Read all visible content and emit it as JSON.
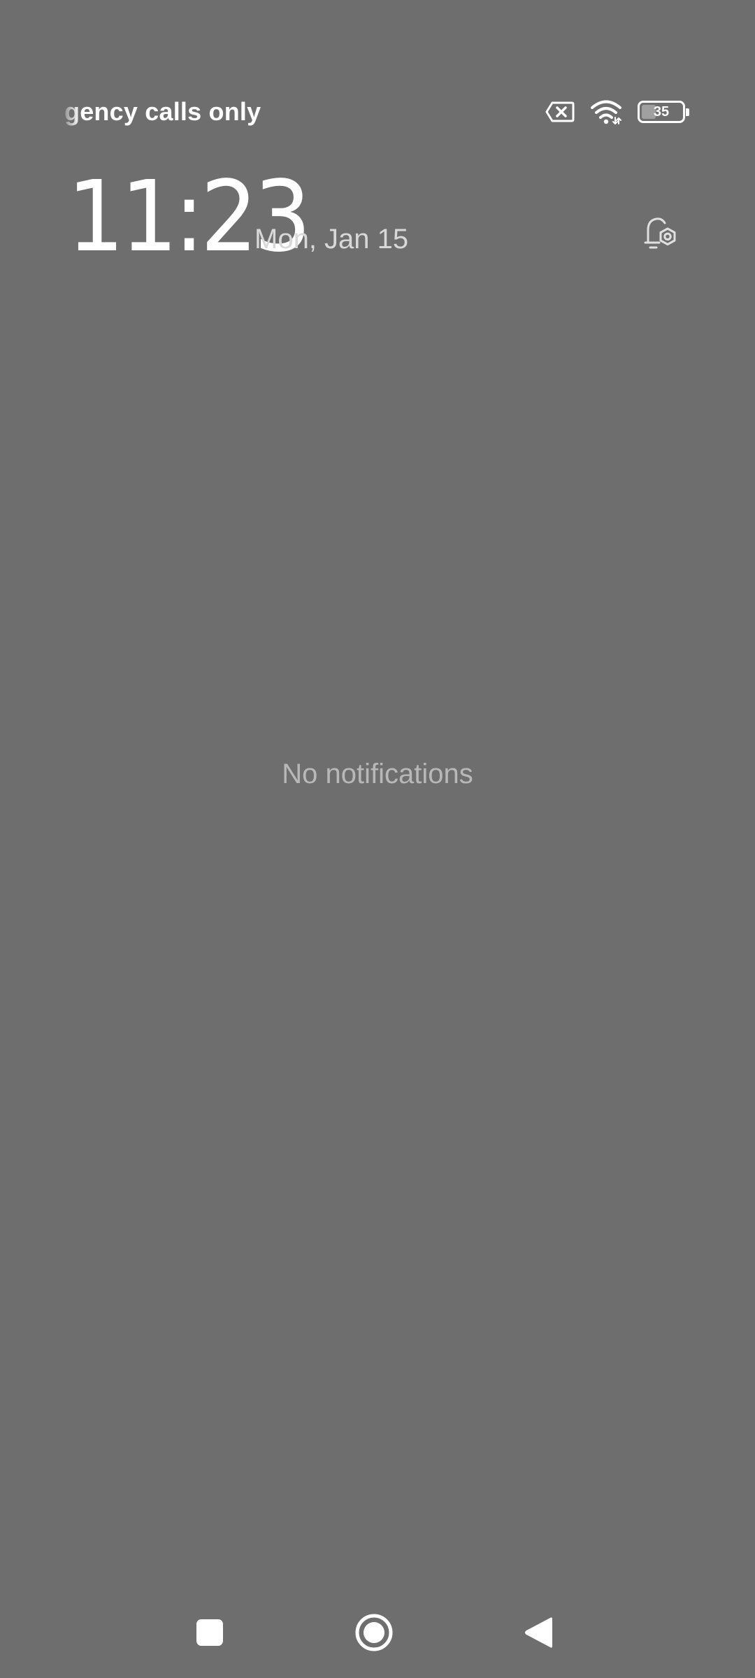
{
  "status_bar": {
    "carrier_text": "gency calls only",
    "icons": [
      "no-sim-icon",
      "wifi-icon",
      "battery-icon"
    ],
    "battery_percent": 35,
    "battery_label": "35"
  },
  "header": {
    "time": "11:23",
    "date": "Mon, Jan 15",
    "settings_icon": "notification-settings-icon"
  },
  "notifications": {
    "empty_text": "No notifications"
  },
  "nav_bar": {
    "buttons": [
      "recents-button",
      "home-button",
      "back-button"
    ]
  },
  "colors": {
    "background": "#6e6e6e",
    "foreground": "#ffffff",
    "date_text": "#d8d8d8",
    "muted_text": "#b8b8b8"
  }
}
